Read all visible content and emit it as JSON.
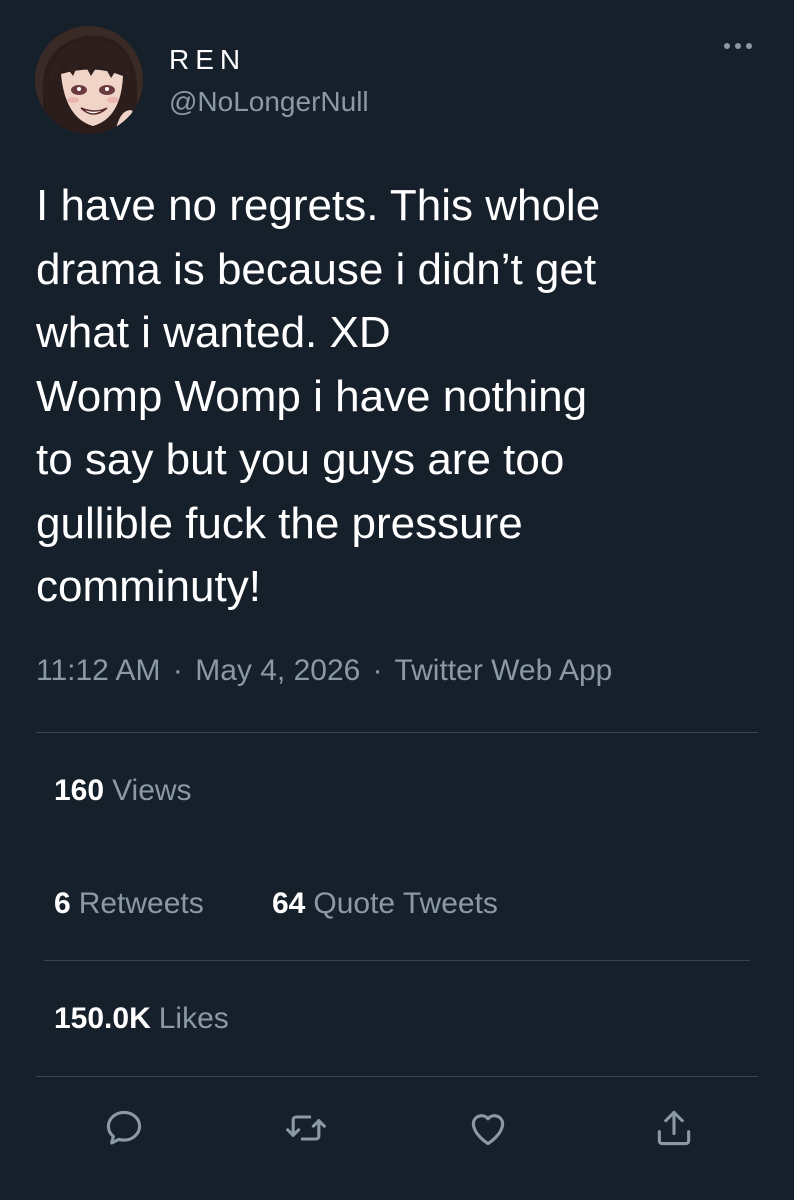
{
  "header": {
    "display_name": "REN",
    "handle": "@NoLongerNull",
    "avatar_icon": "anime-avatar"
  },
  "tweet": {
    "text": "I have no regrets. This whole\ndrama is because i didn’t get\nwhat i wanted. XD\nWomp Womp i have nothing\nto say but you guys are too\ngullible fuck the pressure\ncomminuty!"
  },
  "meta": {
    "time": "11:12 AM",
    "date": "May 4, 2026",
    "source": "Twitter Web App",
    "separator": "·"
  },
  "stats": {
    "views_count": "160",
    "views_label": "Views",
    "retweets_count": "6",
    "retweets_label": "Retweets",
    "quotes_count": "64",
    "quotes_label": "Quote Tweets",
    "likes_count": "150.0K",
    "likes_label": "Likes"
  },
  "actions": [
    "reply-icon",
    "retweet-icon",
    "like-icon",
    "share-icon"
  ],
  "colors": {
    "background": "#15202b",
    "text_primary": "#ffffff",
    "text_secondary": "#8b98a5",
    "divider": "#38444d"
  }
}
